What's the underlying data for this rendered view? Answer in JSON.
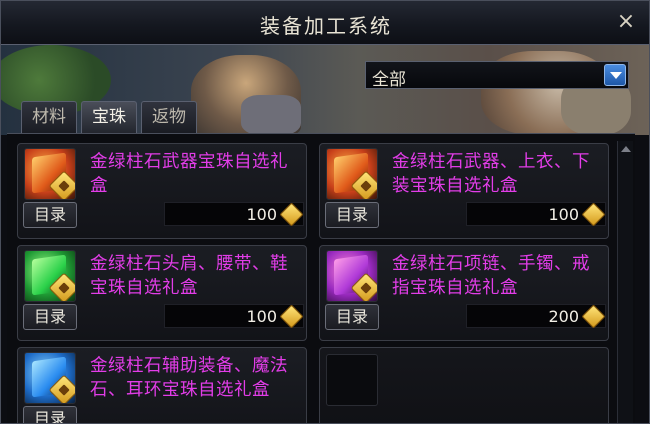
{
  "window": {
    "title": "装备加工系统",
    "close_label": "×"
  },
  "filter": {
    "selected": "全部"
  },
  "tabs": [
    {
      "label": "材料",
      "active": false
    },
    {
      "label": "宝珠",
      "active": true
    },
    {
      "label": "返物",
      "active": false
    }
  ],
  "items": [
    {
      "name": "金绿柱石武器宝珠自选礼盒",
      "catalog_label": "目录",
      "price": "100",
      "icon": "gem-box-orange-icon"
    },
    {
      "name": "金绿柱石武器、上衣、下装宝珠自选礼盒",
      "catalog_label": "目录",
      "price": "100",
      "icon": "gem-box-orange-icon"
    },
    {
      "name": "金绿柱石头肩、腰带、鞋宝珠自选礼盒",
      "catalog_label": "目录",
      "price": "100",
      "icon": "gem-box-green-icon"
    },
    {
      "name": "金绿柱石项链、手镯、戒指宝珠自选礼盒",
      "catalog_label": "目录",
      "price": "200",
      "icon": "gem-box-purple-icon"
    },
    {
      "name": "金绿柱石辅助装备、魔法石、耳环宝珠自选礼盒",
      "catalog_label": "目录",
      "price": "",
      "icon": "gem-box-blue-icon"
    }
  ],
  "colors": {
    "item_name": "#e23de8",
    "gem_orange": "#e05a1a",
    "gem_green": "#2bd14a",
    "gem_purple": "#b03ad8",
    "gem_blue": "#2a8cf0",
    "currency": "#f0c040"
  }
}
